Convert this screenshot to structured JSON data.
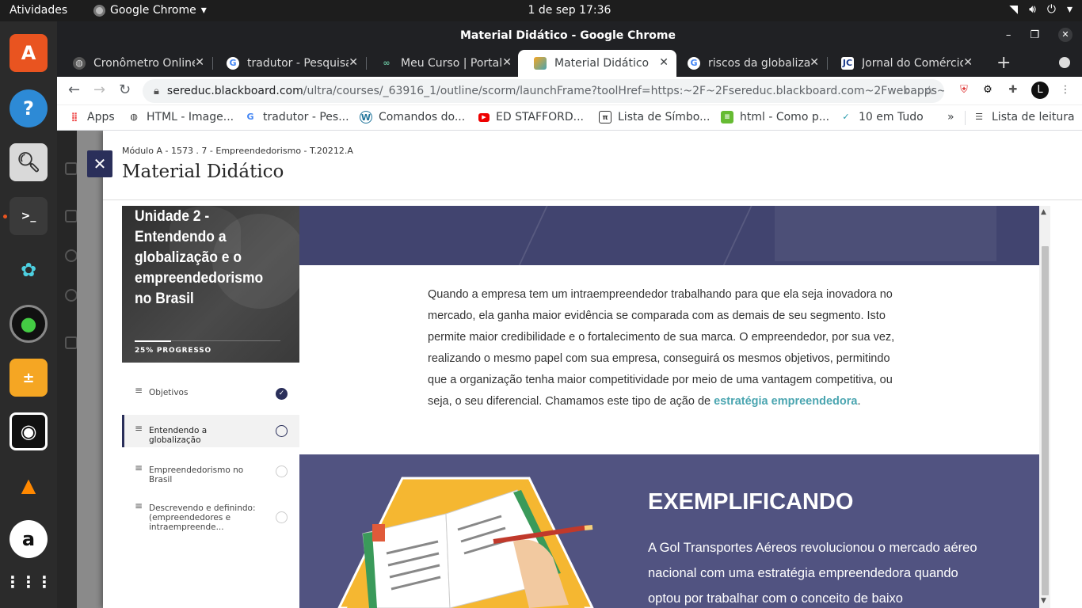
{
  "topbar": {
    "activities": "Atividades",
    "app": "Google Chrome",
    "clock": "1 de sep  17:36"
  },
  "window": {
    "title": "Material Didático - Google Chrome"
  },
  "tabs": [
    {
      "label": "Cronômetro Online",
      "icon": "globe-icon",
      "active": false
    },
    {
      "label": "tradutor - Pesquisa",
      "icon": "google-icon",
      "active": false
    },
    {
      "label": "Meu Curso | Portal",
      "icon": "portal-icon",
      "active": false
    },
    {
      "label": "Material Didático",
      "icon": "scorm-icon",
      "active": true
    },
    {
      "label": "riscos da globalização",
      "icon": "google-icon",
      "active": false
    },
    {
      "label": "Jornal do Comércio",
      "icon": "jc-icon",
      "active": false
    }
  ],
  "url": {
    "host": "sereduc.blackboard.com",
    "path": "/ultra/courses/_63916_1/outline/scorm/launchFrame?toolHref=https:~2F~2Fsereduc.blackboard.com~2Fwebapps~2F..."
  },
  "bookmarks": [
    {
      "label": "Apps",
      "icon": "apps-icon"
    },
    {
      "label": "HTML - Image...",
      "icon": "globe-icon"
    },
    {
      "label": "tradutor - Pes...",
      "icon": "google-icon"
    },
    {
      "label": "Comandos do...",
      "icon": "wordpress-icon"
    },
    {
      "label": "ED STAFFORD...",
      "icon": "youtube-icon"
    },
    {
      "label": "Lista de Símbo...",
      "icon": "symbol-icon"
    },
    {
      "label": "html - Como p...",
      "icon": "stackexchange-icon"
    },
    {
      "label": "10 em Tudo",
      "icon": "check-icon"
    }
  ],
  "reading_list": "Lista de leitura",
  "panel": {
    "breadcrumb": "Módulo A - 1573 . 7 - Empreendedorismo - T.20212.A",
    "title": "Material Didático"
  },
  "unit": {
    "title": "Unidade 2 - Entendendo a globalização e o empreendedorismo no Brasil",
    "progress_label": "25% PROGRESSO",
    "progress_fraction": 0.25
  },
  "sidebar_items": [
    {
      "label": "Objetivos",
      "state": "done"
    },
    {
      "label": "Entendendo a globalização",
      "state": "current"
    },
    {
      "label": "Empreendedorismo no Brasil",
      "state": "todo"
    },
    {
      "label": "Descrevendo e definindo: (empreendedores e intraempreende...",
      "state": "todo"
    }
  ],
  "body": {
    "paragraph": "Quando a empresa tem um intraempreendedor trabalhando para que ela seja inovadora no mercado, ela ganha maior evidência se comparada com as demais de seu segmento. Isto permite maior credibilidade e o fortalecimento de sua marca. O empreendedor, por sua vez, realizando o mesmo papel com sua empresa, conseguirá os mesmos objetivos, permitindo que a organização tenha maior competitividade por meio de uma vantagem competitiva, ou seja, o seu diferencial. Chamamos este tipo de ação de ",
    "highlight": "estratégia empreendedora",
    "end": "."
  },
  "example": {
    "title": "EXEMPLIFICANDO",
    "text": "A Gol Transportes Aéreos revolucionou o mercado aéreo nacional com uma estratégia empreendedora quando optou por trabalhar com o conceito de baixo"
  },
  "colors": {
    "accent": "#2a2f5a",
    "highlight": "#4aa5b0",
    "example_bg": "#515381",
    "banner": "#41446f"
  }
}
